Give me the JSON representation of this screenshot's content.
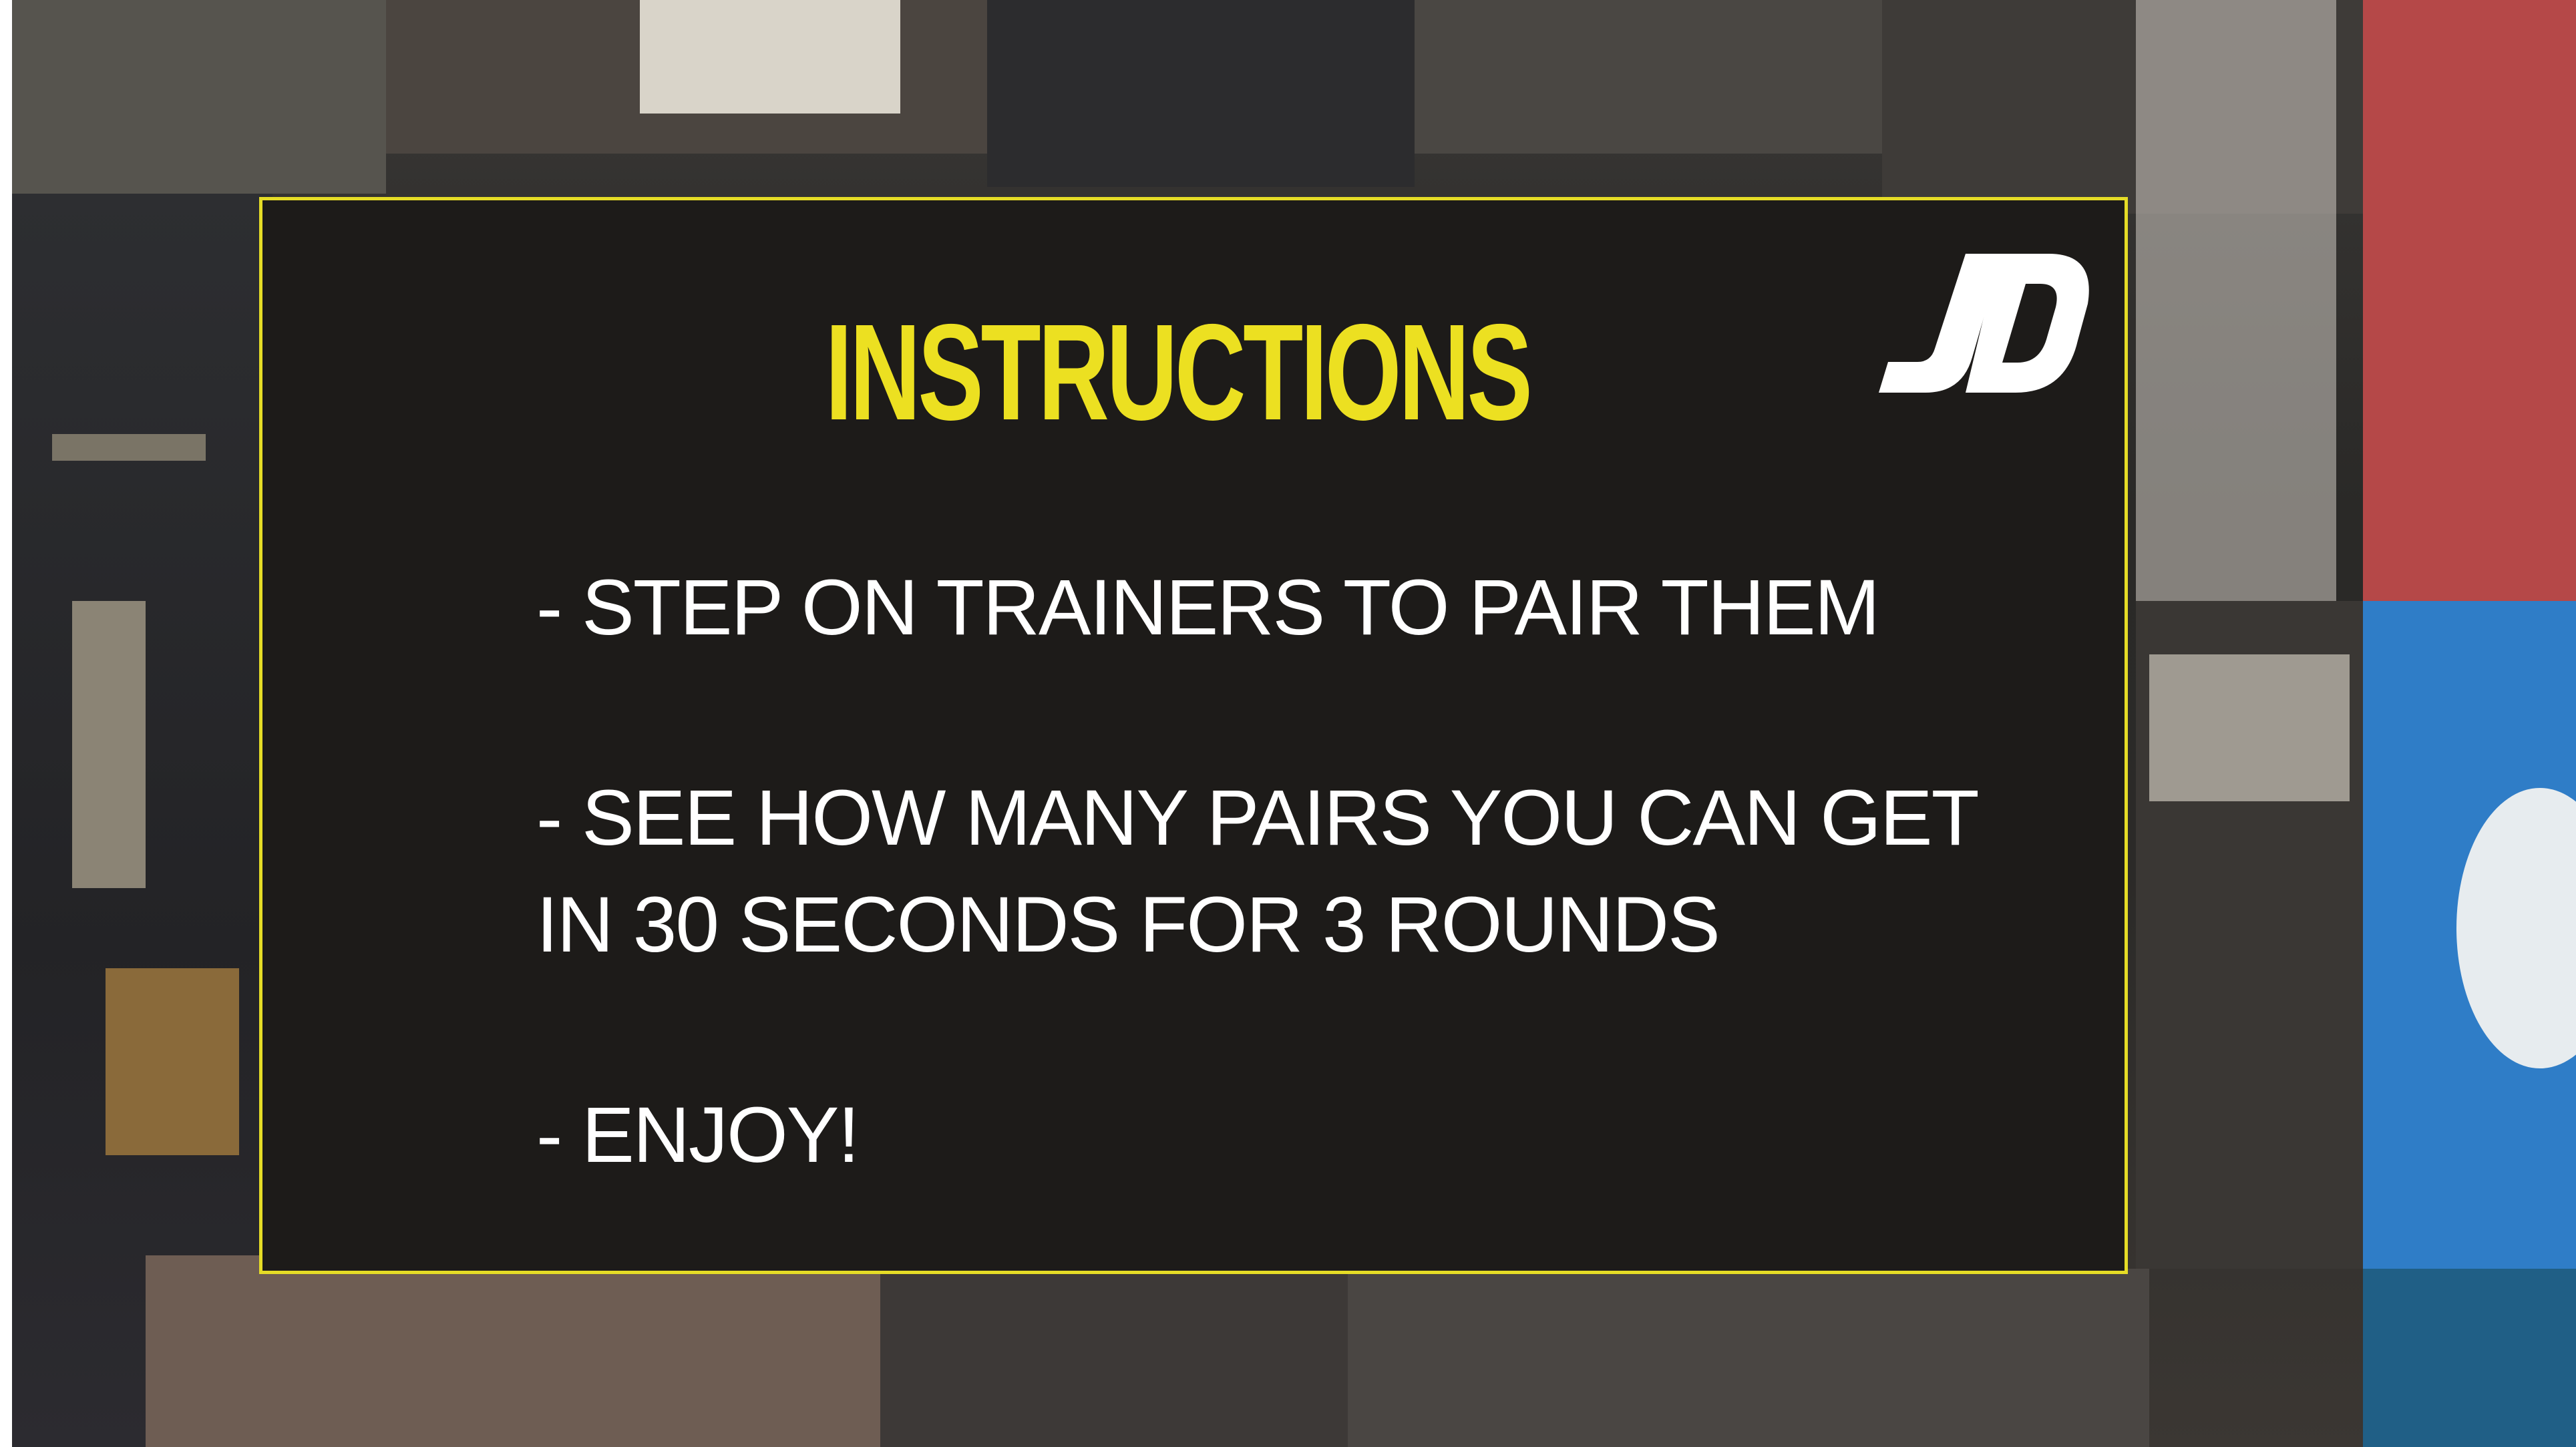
{
  "title": "INSTRUCTIONS",
  "logo_text": "JD",
  "instructions": [
    "- STEP ON TRAINERS TO PAIR THEM",
    "- SEE HOW MANY PAIRS YOU CAN GET",
    "IN 30 SECONDS FOR 3 ROUNDS",
    "- ENJOY!"
  ],
  "colors": {
    "accent": "#e5dc26",
    "panel": "#1d1b19",
    "text": "#ffffff"
  },
  "icons": {
    "logo": "jd-logo-icon"
  }
}
